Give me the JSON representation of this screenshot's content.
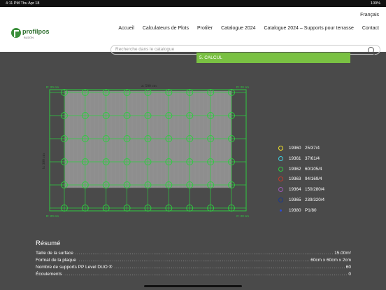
{
  "status": {
    "time": "4:11 PM  Thu Apr 18",
    "battery": "100%"
  },
  "header": {
    "language": "Français",
    "logo_text": "profilpos",
    "logo_sub": "BUZON",
    "nav": [
      "Accueil",
      "Calculateurs de Plots",
      "Protiler",
      "Catalogue 2024",
      "Catalogue 2024 – Supports pour terrasse",
      "Contact"
    ],
    "search_placeholder": "Recherche dans le catalogue"
  },
  "calc_bar": "5. CALCUL",
  "plan": {
    "width_label": "a: 500 cm",
    "height_label": "b: 300 cm",
    "corner_labels": [
      "D: 20 cm",
      "D: 20 cm",
      "D: 20 cm",
      "C: 20 cm"
    ],
    "grid_cols": 9,
    "grid_rows": 6,
    "colors": {
      "frame": "#2ecc40",
      "fill": "#8e8e8e",
      "support": "#2ecc40"
    }
  },
  "legend": [
    {
      "code": "19360",
      "size": "25/37/4",
      "color": "#f1e12a"
    },
    {
      "code": "19361",
      "size": "37/61/4",
      "color": "#3fd0e0"
    },
    {
      "code": "19362",
      "size": "60/105/4",
      "color": "#2ecc40"
    },
    {
      "code": "19363",
      "size": "94/169/4",
      "color": "#c0392b"
    },
    {
      "code": "19364",
      "size": "150/280/4",
      "color": "#9b59b6"
    },
    {
      "code": "19365",
      "size": "239/320/4",
      "color": "#1e3a8a"
    },
    {
      "code": "19380",
      "size": "P1/80",
      "color": "#2b4bd6"
    }
  ],
  "resume": {
    "title": "Résumé",
    "rows": [
      {
        "label": "Taille de la surface",
        "value": "15.00m²"
      },
      {
        "label": "Format de la plaque",
        "value": "60cm x 60cm x 2cm"
      },
      {
        "label": "Nombre de supports PP Level DUO ®",
        "value": "60"
      },
      {
        "label": "Écoulements",
        "value": "0"
      }
    ]
  }
}
